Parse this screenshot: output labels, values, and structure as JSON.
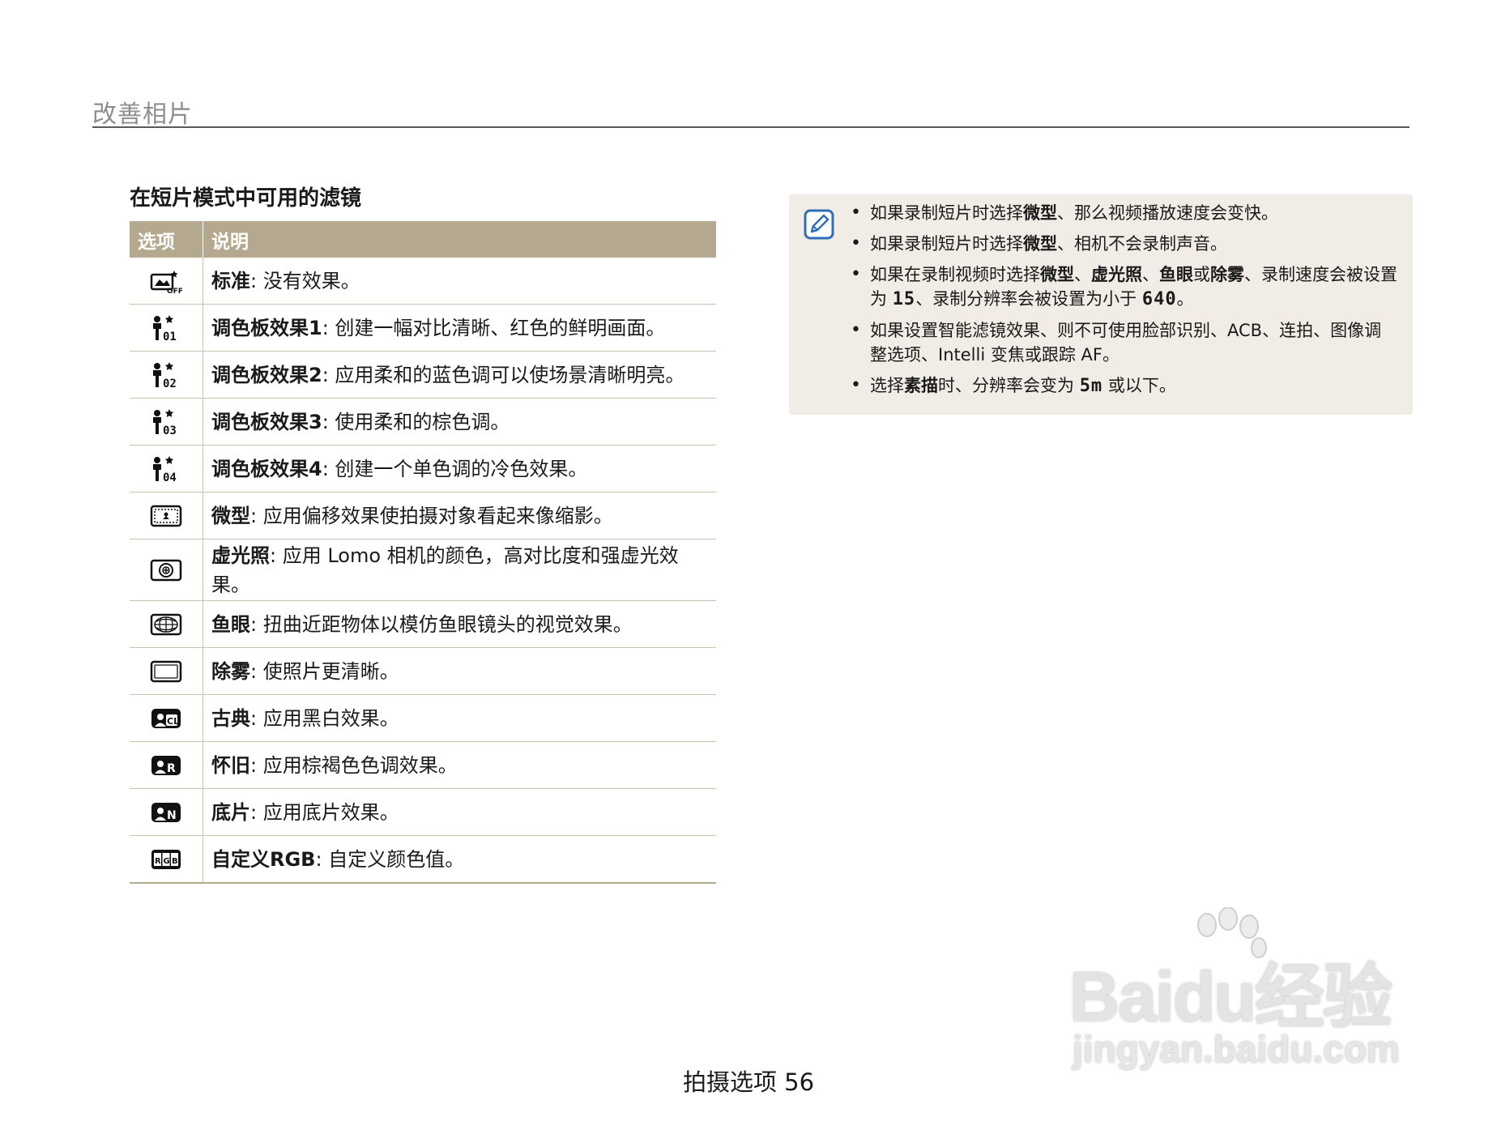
{
  "header": {
    "title": "改善相片"
  },
  "section": {
    "title": "在短片模式中可用的滤镜"
  },
  "table": {
    "headers": [
      "选项",
      "说明"
    ],
    "rows": [
      {
        "icon": "filter-off-icon",
        "name": "标准",
        "desc": ": 没有效果。"
      },
      {
        "icon": "palette-1-icon",
        "name": "调色板效果1",
        "desc": ": 创建一幅对比清晰、红色的鲜明画面。"
      },
      {
        "icon": "palette-2-icon",
        "name": "调色板效果2",
        "desc": ": 应用柔和的蓝色调可以使场景清晰明亮。"
      },
      {
        "icon": "palette-3-icon",
        "name": "调色板效果3",
        "desc": ": 使用柔和的棕色调。"
      },
      {
        "icon": "palette-4-icon",
        "name": "调色板效果4",
        "desc": ": 创建一个单色调的冷色效果。"
      },
      {
        "icon": "miniature-icon",
        "name": "微型",
        "desc": ": 应用偏移效果使拍摄对象看起来像缩影。"
      },
      {
        "icon": "vignetting-icon",
        "name": "虚光照",
        "desc": ": 应用 Lomo 相机的颜色，高对比度和强虚光效果。"
      },
      {
        "icon": "fisheye-icon",
        "name": "鱼眼",
        "desc": ": 扭曲近距物体以模仿鱼眼镜头的视觉效果。"
      },
      {
        "icon": "defog-icon",
        "name": "除雾",
        "desc": ": 使照片更清晰。"
      },
      {
        "icon": "classic-icon",
        "name": "古典",
        "desc": ": 应用黑白效果。"
      },
      {
        "icon": "retro-icon",
        "name": "怀旧",
        "desc": ": 应用棕褐色色调效果。"
      },
      {
        "icon": "negative-icon",
        "name": "底片",
        "desc": ": 应用底片效果。"
      },
      {
        "icon": "custom-rgb-icon",
        "name": "自定义RGB",
        "desc": ": 自定义颜色值。"
      }
    ]
  },
  "notes": {
    "icon": "note-pencil-icon",
    "n1": {
      "a": "如果录制短片时选择",
      "b": "微型",
      "c": "、那么视频播放速度会变快。"
    },
    "n2": {
      "a": "如果录制短片时选择",
      "b": "微型",
      "c": "、相机不会录制声音。"
    },
    "n3": {
      "a": "如果在录制视频时选择",
      "b": "微型",
      "c": "、",
      "d": "虚光照",
      "e": "、",
      "f": "鱼眼",
      "g": "或",
      "h": "除雾",
      "i": "、录制速度会被设置为",
      "glyph1": "15",
      "j": "、录制分辨率会被设置为小于",
      "glyph2": "640",
      "k": "。"
    },
    "n4": {
      "a": "如果设置智能滤镜效果、则不可使用脸部识别、ACB、连拍、图像调整选项、Intelli 变焦或跟踪 AF。"
    },
    "n5": {
      "a": "选择",
      "b": "素描",
      "c": "时、分辨率会变为",
      "glyph": "5m",
      "d": "或以下。"
    }
  },
  "footer": {
    "text": "拍摄选项 56"
  },
  "watermark": {
    "brand": "Baidu经验",
    "url": "jingyan.baidu.com"
  }
}
